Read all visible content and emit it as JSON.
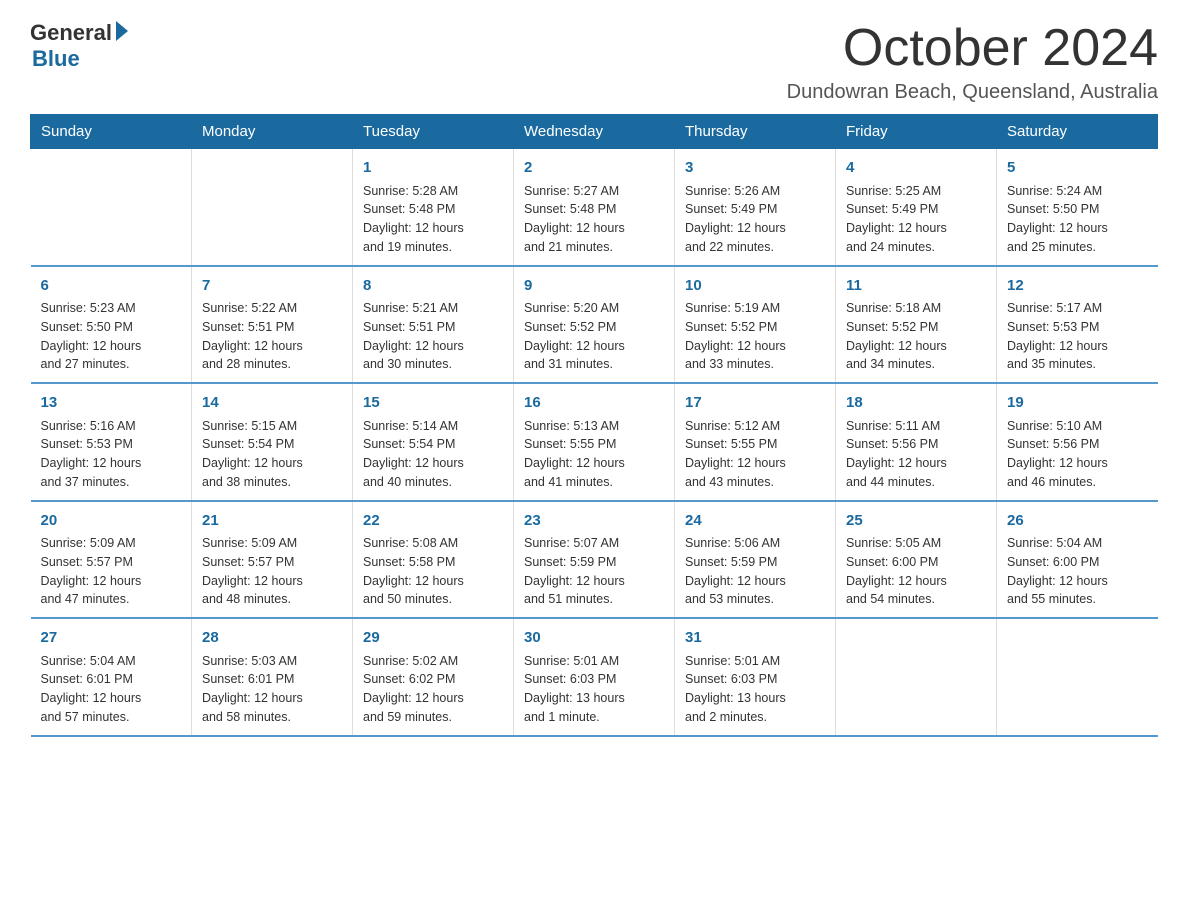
{
  "header": {
    "logo_general": "General",
    "logo_blue": "Blue",
    "month_title": "October 2024",
    "location": "Dundowran Beach, Queensland, Australia"
  },
  "calendar": {
    "days_of_week": [
      "Sunday",
      "Monday",
      "Tuesday",
      "Wednesday",
      "Thursday",
      "Friday",
      "Saturday"
    ],
    "weeks": [
      [
        {
          "day": "",
          "info": ""
        },
        {
          "day": "",
          "info": ""
        },
        {
          "day": "1",
          "info": "Sunrise: 5:28 AM\nSunset: 5:48 PM\nDaylight: 12 hours\nand 19 minutes."
        },
        {
          "day": "2",
          "info": "Sunrise: 5:27 AM\nSunset: 5:48 PM\nDaylight: 12 hours\nand 21 minutes."
        },
        {
          "day": "3",
          "info": "Sunrise: 5:26 AM\nSunset: 5:49 PM\nDaylight: 12 hours\nand 22 minutes."
        },
        {
          "day": "4",
          "info": "Sunrise: 5:25 AM\nSunset: 5:49 PM\nDaylight: 12 hours\nand 24 minutes."
        },
        {
          "day": "5",
          "info": "Sunrise: 5:24 AM\nSunset: 5:50 PM\nDaylight: 12 hours\nand 25 minutes."
        }
      ],
      [
        {
          "day": "6",
          "info": "Sunrise: 5:23 AM\nSunset: 5:50 PM\nDaylight: 12 hours\nand 27 minutes."
        },
        {
          "day": "7",
          "info": "Sunrise: 5:22 AM\nSunset: 5:51 PM\nDaylight: 12 hours\nand 28 minutes."
        },
        {
          "day": "8",
          "info": "Sunrise: 5:21 AM\nSunset: 5:51 PM\nDaylight: 12 hours\nand 30 minutes."
        },
        {
          "day": "9",
          "info": "Sunrise: 5:20 AM\nSunset: 5:52 PM\nDaylight: 12 hours\nand 31 minutes."
        },
        {
          "day": "10",
          "info": "Sunrise: 5:19 AM\nSunset: 5:52 PM\nDaylight: 12 hours\nand 33 minutes."
        },
        {
          "day": "11",
          "info": "Sunrise: 5:18 AM\nSunset: 5:52 PM\nDaylight: 12 hours\nand 34 minutes."
        },
        {
          "day": "12",
          "info": "Sunrise: 5:17 AM\nSunset: 5:53 PM\nDaylight: 12 hours\nand 35 minutes."
        }
      ],
      [
        {
          "day": "13",
          "info": "Sunrise: 5:16 AM\nSunset: 5:53 PM\nDaylight: 12 hours\nand 37 minutes."
        },
        {
          "day": "14",
          "info": "Sunrise: 5:15 AM\nSunset: 5:54 PM\nDaylight: 12 hours\nand 38 minutes."
        },
        {
          "day": "15",
          "info": "Sunrise: 5:14 AM\nSunset: 5:54 PM\nDaylight: 12 hours\nand 40 minutes."
        },
        {
          "day": "16",
          "info": "Sunrise: 5:13 AM\nSunset: 5:55 PM\nDaylight: 12 hours\nand 41 minutes."
        },
        {
          "day": "17",
          "info": "Sunrise: 5:12 AM\nSunset: 5:55 PM\nDaylight: 12 hours\nand 43 minutes."
        },
        {
          "day": "18",
          "info": "Sunrise: 5:11 AM\nSunset: 5:56 PM\nDaylight: 12 hours\nand 44 minutes."
        },
        {
          "day": "19",
          "info": "Sunrise: 5:10 AM\nSunset: 5:56 PM\nDaylight: 12 hours\nand 46 minutes."
        }
      ],
      [
        {
          "day": "20",
          "info": "Sunrise: 5:09 AM\nSunset: 5:57 PM\nDaylight: 12 hours\nand 47 minutes."
        },
        {
          "day": "21",
          "info": "Sunrise: 5:09 AM\nSunset: 5:57 PM\nDaylight: 12 hours\nand 48 minutes."
        },
        {
          "day": "22",
          "info": "Sunrise: 5:08 AM\nSunset: 5:58 PM\nDaylight: 12 hours\nand 50 minutes."
        },
        {
          "day": "23",
          "info": "Sunrise: 5:07 AM\nSunset: 5:59 PM\nDaylight: 12 hours\nand 51 minutes."
        },
        {
          "day": "24",
          "info": "Sunrise: 5:06 AM\nSunset: 5:59 PM\nDaylight: 12 hours\nand 53 minutes."
        },
        {
          "day": "25",
          "info": "Sunrise: 5:05 AM\nSunset: 6:00 PM\nDaylight: 12 hours\nand 54 minutes."
        },
        {
          "day": "26",
          "info": "Sunrise: 5:04 AM\nSunset: 6:00 PM\nDaylight: 12 hours\nand 55 minutes."
        }
      ],
      [
        {
          "day": "27",
          "info": "Sunrise: 5:04 AM\nSunset: 6:01 PM\nDaylight: 12 hours\nand 57 minutes."
        },
        {
          "day": "28",
          "info": "Sunrise: 5:03 AM\nSunset: 6:01 PM\nDaylight: 12 hours\nand 58 minutes."
        },
        {
          "day": "29",
          "info": "Sunrise: 5:02 AM\nSunset: 6:02 PM\nDaylight: 12 hours\nand 59 minutes."
        },
        {
          "day": "30",
          "info": "Sunrise: 5:01 AM\nSunset: 6:03 PM\nDaylight: 13 hours\nand 1 minute."
        },
        {
          "day": "31",
          "info": "Sunrise: 5:01 AM\nSunset: 6:03 PM\nDaylight: 13 hours\nand 2 minutes."
        },
        {
          "day": "",
          "info": ""
        },
        {
          "day": "",
          "info": ""
        }
      ]
    ]
  }
}
